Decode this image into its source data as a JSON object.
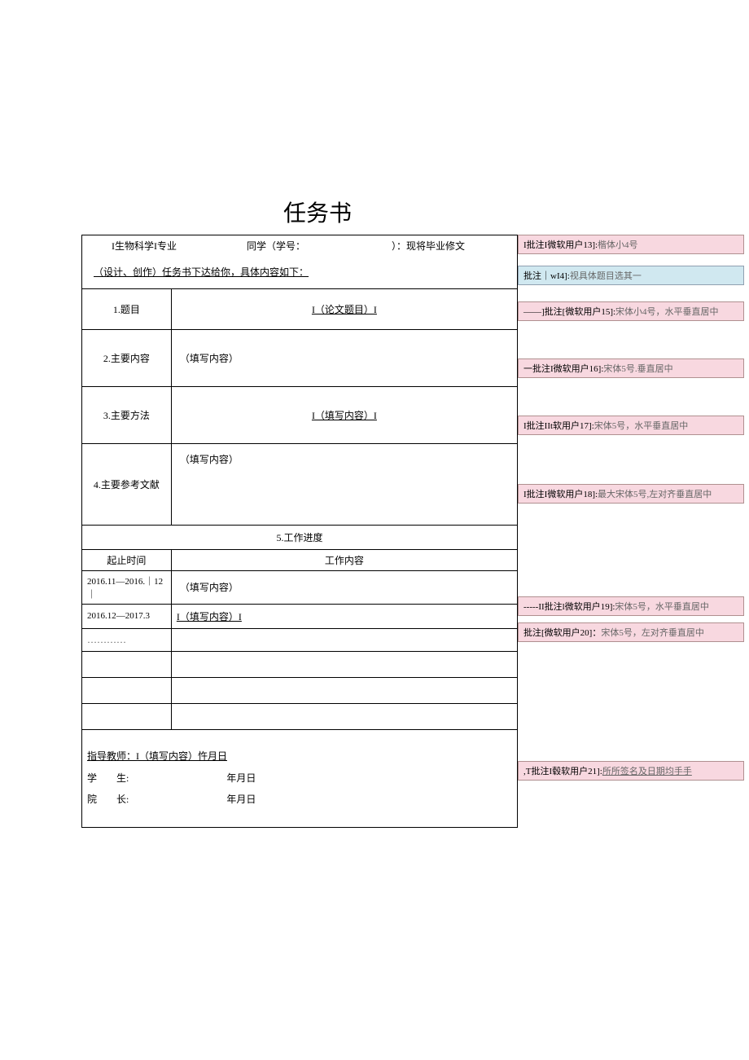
{
  "title": "任务书",
  "header": {
    "major_prefix": "I生物科学I专业",
    "student_label": "同学（学号：",
    "student_suffix": "）：现将毕业修文",
    "line2": "（设计、创作）任务书下达给你，具体内容如下："
  },
  "rows": {
    "r1_label": "1.题目",
    "r1_content": "I（论文题目）I",
    "r2_label": "2.主要内容",
    "r2_content": "（填写内容）",
    "r3_label": "3.主要方法",
    "r3_content": "I（填写内容）I",
    "r4_label": "4.主要参考文献",
    "r4_content": "（填写内容）",
    "r5_header": "5.工作进度",
    "r5_col1": "起止时间",
    "r5_col2": "工作内容",
    "r6_time": "2016.11—2016.｜12｜",
    "r6_content": "（填写内容）",
    "r7_time": "2016.12—2017.3",
    "r7_content": "I（填写内容）I",
    "r8_time": "…………"
  },
  "signatures": {
    "teacher": "指导教师：I（填写内容）忤月日",
    "student": "学　　生:",
    "student_date": "年月日",
    "dean": "院　　长:",
    "dean_date": "年月日"
  },
  "comments": {
    "c13": {
      "author": "I批注I微软用户13]:",
      "text": "楷体小4号"
    },
    "c14": {
      "author": "批注｜wI4]:",
      "text": "视具体题目选其一"
    },
    "c15": {
      "author": "——]批注[微软用户15]:",
      "text": "宋体小4号，水平垂直居中"
    },
    "c16": {
      "author": "一批注I微软用户16]:",
      "text": "宋体5号.垂直居中"
    },
    "c17": {
      "author": "I批注IIt软用户17]:",
      "text": "宋体5号，水平垂直居中"
    },
    "c18": {
      "author": "I批注I微软用户18]:",
      "text": "最大宋体5号,左对齐垂直居中"
    },
    "c19": {
      "author": "-----II批注l微软用户19]:",
      "text": "宋体5号，水平垂直居中"
    },
    "c20": {
      "author": "批注[微软用户20]：",
      "text": "宋体5号，左对齐垂直居中"
    },
    "c21": {
      "author": ",T批注I毂软用户21]:",
      "text": "所所签名及日期均手手"
    }
  }
}
